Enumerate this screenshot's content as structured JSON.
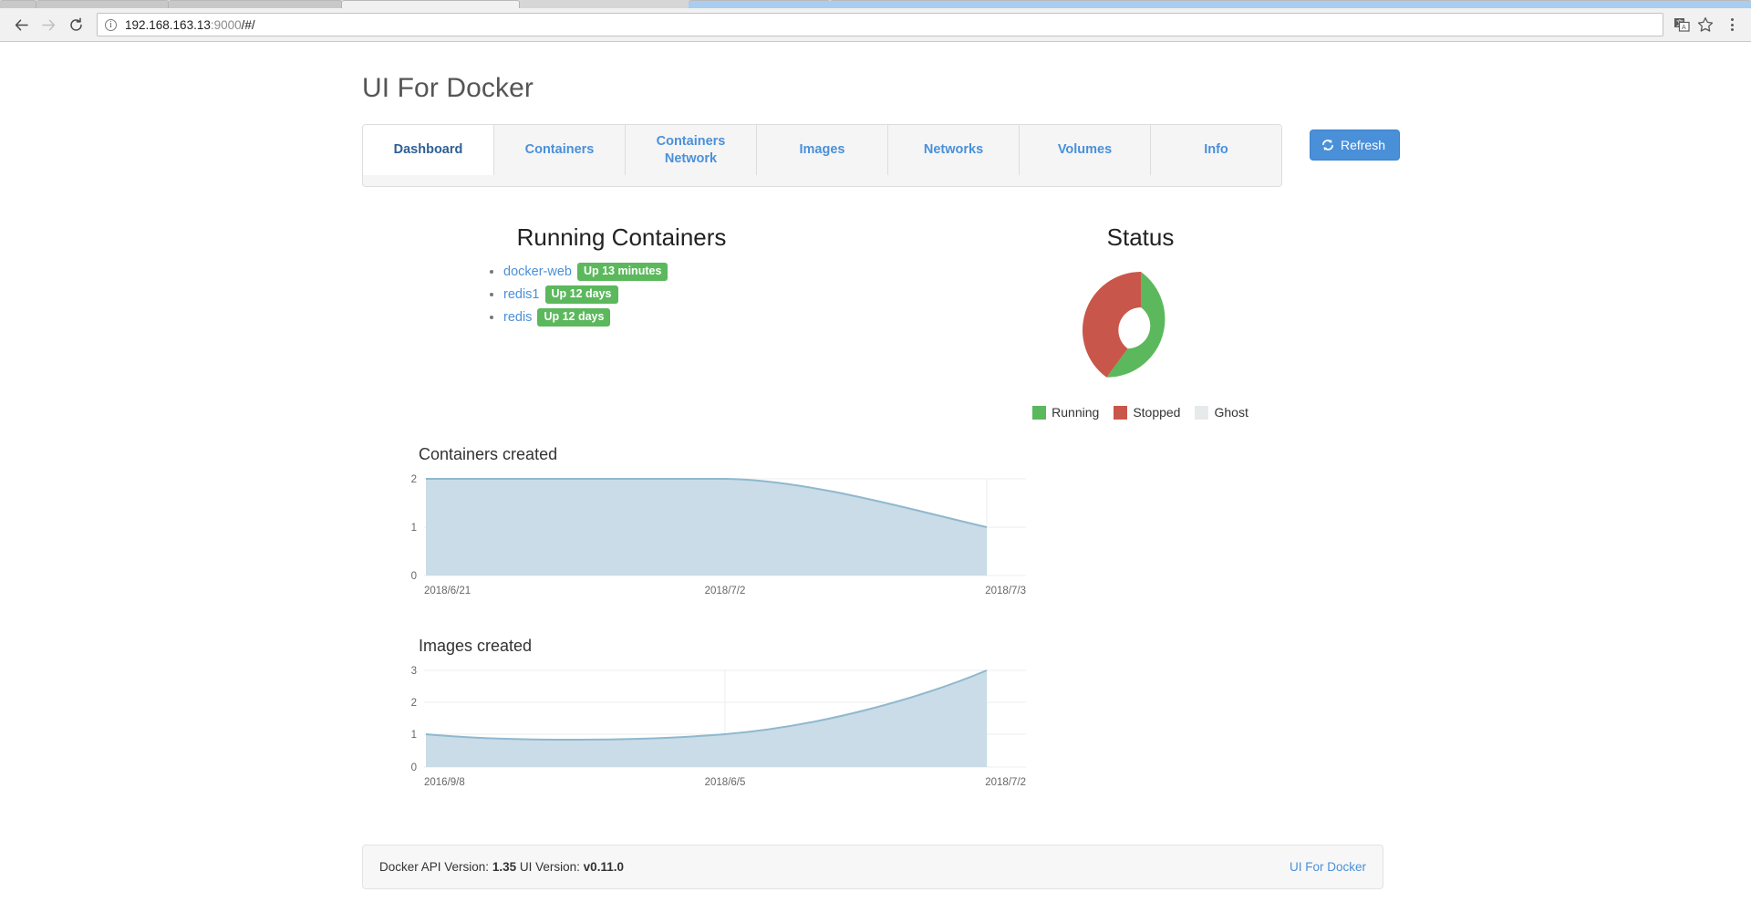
{
  "browser": {
    "url_host": "192.168.163.13",
    "url_rest": ":9000",
    "url_path": "/#/",
    "back_icon": "back-arrow-icon",
    "forward_icon": "forward-arrow-icon",
    "reload_icon": "reload-icon",
    "info_icon": "info-icon",
    "translate_icon": "translate-icon",
    "bookmark_icon": "star-icon",
    "menu_icon": "three-dots-menu-icon"
  },
  "header": {
    "title": "UI For Docker"
  },
  "nav": {
    "tabs": [
      {
        "label": "Dashboard",
        "active": true
      },
      {
        "label": "Containers",
        "active": false
      },
      {
        "label": "Containers Network",
        "active": false
      },
      {
        "label": "Images",
        "active": false
      },
      {
        "label": "Networks",
        "active": false
      },
      {
        "label": "Volumes",
        "active": false
      },
      {
        "label": "Info",
        "active": false
      }
    ],
    "refresh_label": "Refresh",
    "refresh_icon": "refresh-icon",
    "accent_color": "#4a90d9"
  },
  "running": {
    "title": "Running Containers",
    "items": [
      {
        "name": "docker-web",
        "status": "Up 13 minutes"
      },
      {
        "name": "redis1",
        "status": "Up 12 days"
      },
      {
        "name": "redis",
        "status": "Up 12 days"
      }
    ],
    "badge_color": "#5cb85c"
  },
  "status": {
    "title": "Status",
    "legend": [
      {
        "label": "Running",
        "color": "#5cb85c"
      },
      {
        "label": "Stopped",
        "color": "#c9564a"
      },
      {
        "label": "Ghost",
        "color": "#e6eaea"
      }
    ]
  },
  "chart_data": [
    {
      "type": "pie",
      "title": "Status",
      "donut": true,
      "legend_position": "bottom",
      "labels": [
        "Running",
        "Stopped",
        "Ghost"
      ],
      "values": [
        3,
        2,
        0
      ],
      "colors": [
        "#5cb85c",
        "#c9564a",
        "#e6eaea"
      ]
    },
    {
      "type": "area",
      "title": "Containers created",
      "xlabel": "",
      "ylabel": "",
      "ylim": [
        0,
        2
      ],
      "yticks": [
        0,
        1,
        2
      ],
      "grid": true,
      "x": [
        "2018/6/21",
        "2018/7/2",
        "2018/7/3"
      ],
      "xticks": [
        "2018/6/21",
        "2018/7/2",
        "2018/7/3"
      ],
      "values": [
        2,
        2,
        1
      ],
      "line_color": "#8fb8ce",
      "fill_color": "#c9dce7"
    },
    {
      "type": "area",
      "title": "Images created",
      "xlabel": "",
      "ylabel": "",
      "ylim": [
        0,
        3
      ],
      "yticks": [
        0,
        1,
        2,
        3
      ],
      "grid": true,
      "x": [
        "2016/9/8",
        "2018/6/5",
        "2018/7/2"
      ],
      "xticks": [
        "2016/9/8",
        "2018/6/5",
        "2018/7/2"
      ],
      "values": [
        1,
        1,
        3
      ],
      "line_color": "#8fb8ce",
      "fill_color": "#c9dce7"
    }
  ],
  "charts": {
    "containers": {
      "title": "Containers created",
      "yticks": [
        "2",
        "1",
        "0"
      ],
      "xticks": [
        "2018/6/21",
        "2018/7/2",
        "2018/7/3"
      ]
    },
    "images": {
      "title": "Images created",
      "yticks": [
        "3",
        "2",
        "1",
        "0"
      ],
      "xticks": [
        "2016/9/8",
        "2018/6/5",
        "2018/7/2"
      ]
    }
  },
  "footer": {
    "api_prefix": "Docker API Version:",
    "api_version": "1.35",
    "ui_prefix": "UI Version:",
    "ui_version": "v0.11.0",
    "link": "UI For Docker"
  }
}
